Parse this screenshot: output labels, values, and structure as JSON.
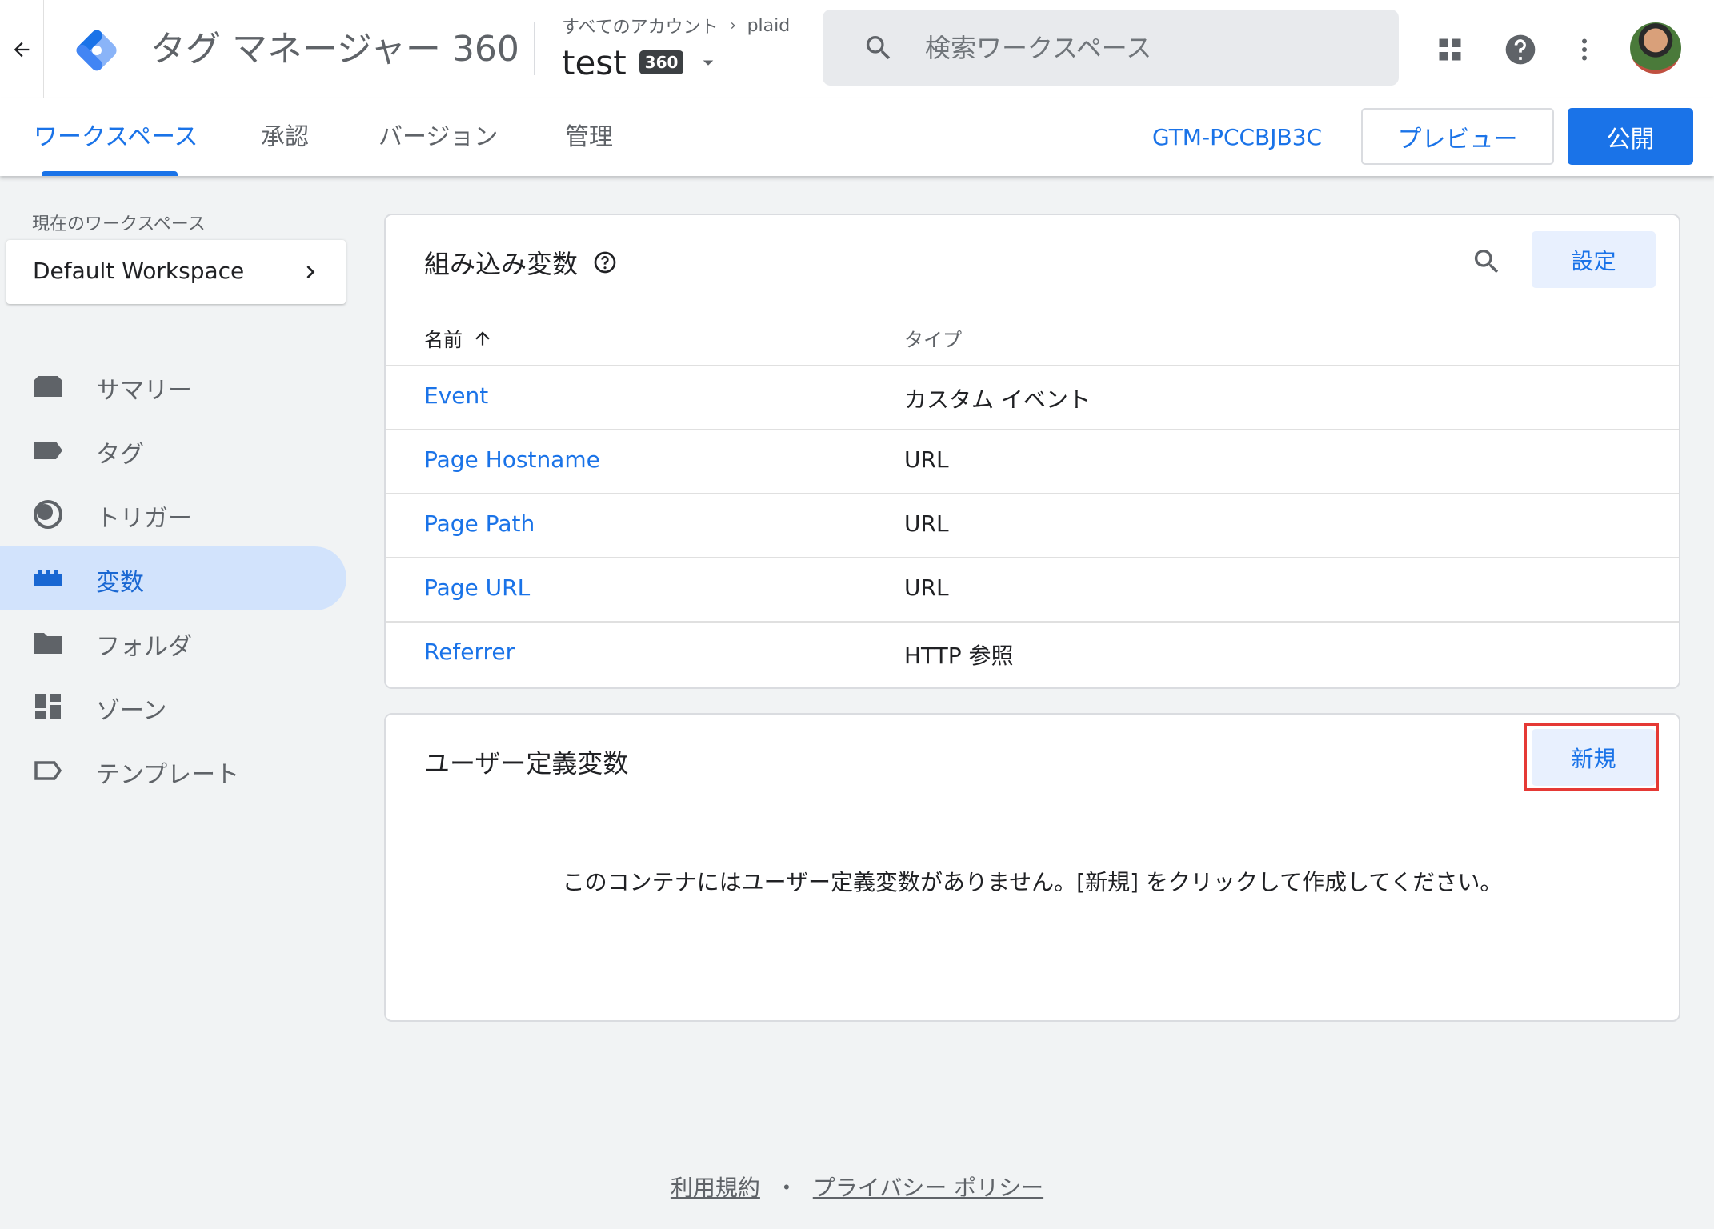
{
  "header": {
    "app_title": "タグ マネージャー 360",
    "breadcrumb_all": "すべてのアカウント",
    "breadcrumb_account": "plaid",
    "container_name": "test",
    "container_badge": "360",
    "search_placeholder": "検索ワークスペース",
    "icons": [
      "back-arrow-icon",
      "gtm-logo-icon",
      "chevron-right-icon",
      "dropdown-arrow-icon",
      "search-icon",
      "apps-grid-icon",
      "help-icon",
      "more-vert-icon"
    ]
  },
  "tabs": [
    {
      "label": "ワークスペース",
      "active": true
    },
    {
      "label": "承認"
    },
    {
      "label": "バージョン"
    },
    {
      "label": "管理"
    }
  ],
  "container_id": "GTM-PCCBJB3C",
  "actions": {
    "preview": "プレビュー",
    "publish": "公開"
  },
  "sidebar": {
    "workspace_label": "現在のワークスペース",
    "workspace_name": "Default Workspace",
    "items": [
      {
        "label": "サマリー",
        "icon": "summary-icon"
      },
      {
        "label": "タグ",
        "icon": "tag-icon"
      },
      {
        "label": "トリガー",
        "icon": "trigger-icon"
      },
      {
        "label": "変数",
        "icon": "variables-icon",
        "active": true
      },
      {
        "label": "フォルダ",
        "icon": "folder-icon"
      },
      {
        "label": "ゾーン",
        "icon": "zone-icon"
      },
      {
        "label": "テンプレート",
        "icon": "template-icon"
      }
    ]
  },
  "builtin": {
    "title": "組み込み変数",
    "settings_label": "設定",
    "col_name": "名前",
    "col_type": "タイプ",
    "rows": [
      {
        "name": "Event",
        "type": "カスタム イベント"
      },
      {
        "name": "Page Hostname",
        "type": "URL"
      },
      {
        "name": "Page Path",
        "type": "URL"
      },
      {
        "name": "Page URL",
        "type": "URL"
      },
      {
        "name": "Referrer",
        "type": "HTTP 参照"
      }
    ]
  },
  "user_defined": {
    "title": "ユーザー定義変数",
    "new_label": "新規",
    "empty_message": "このコンテナにはユーザー定義変数がありません。[新規] をクリックして作成してください。"
  },
  "footer": {
    "terms": "利用規約",
    "separator": "・",
    "privacy": "プライバシー ポリシー"
  },
  "colors": {
    "accent": "#1a73e8",
    "active_nav_bg": "#d2e3fc",
    "highlight": "#e53935"
  }
}
